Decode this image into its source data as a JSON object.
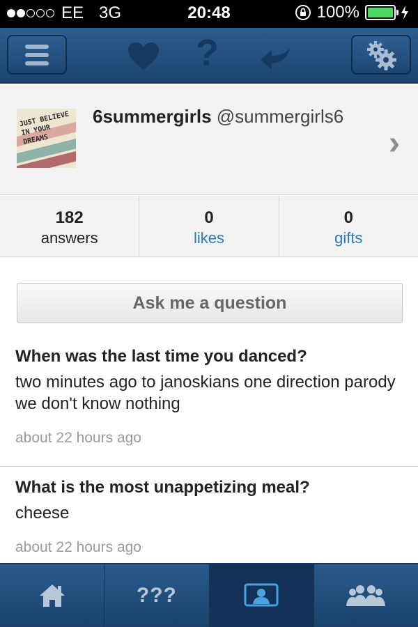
{
  "status_bar": {
    "signal_dots_filled": 2,
    "signal_dots_total": 5,
    "carrier": "EE",
    "network": "3G",
    "time": "20:48",
    "battery": "100%",
    "battery_color": "#4cd964"
  },
  "nav": {
    "menu_icon": "hamburger-menu-icon",
    "icons": [
      "heart-icon",
      "question-mark-icon",
      "reply-arrow-icon"
    ],
    "settings_icon": "gears-icon",
    "question_glyph": "?"
  },
  "profile": {
    "avatar_text": "JUST BELIEVE IN YOUR DREAMS",
    "username": "6summergirls",
    "handle": "@summergirls6"
  },
  "stats": [
    {
      "value": "182",
      "label": "answers"
    },
    {
      "value": "0",
      "label": "likes"
    },
    {
      "value": "0",
      "label": "gifts"
    }
  ],
  "ask_button": "Ask me a question",
  "answers": [
    {
      "question": "When was the last time you danced?",
      "answer": "two minutes ago to janoskians one direction parody we don't know nothing",
      "time": "about 22 hours ago"
    },
    {
      "question": "What is the most unappetizing meal?",
      "answer": "cheese",
      "time": "about 22 hours ago"
    }
  ],
  "tab_bar": {
    "tabs": [
      "home-icon",
      "questions-tab",
      "profile-card-icon",
      "friends-icon"
    ],
    "questions_label": "???",
    "active_index": 2
  },
  "colors": {
    "nav_blue": "#1c4471",
    "link_blue": "#2a7ab8"
  }
}
